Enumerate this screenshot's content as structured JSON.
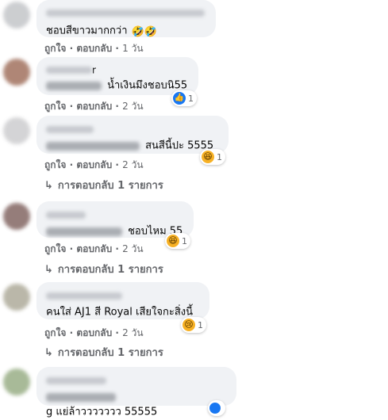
{
  "comments": [
    {
      "text": "ชอบสีขาวมากกว่า",
      "emoji": "🤣🤣",
      "actions": {
        "like": "ถูกใจ",
        "reply": "ตอบกลับ",
        "time": "1 วัน",
        "sep": "·"
      },
      "avatar_color": "#c7c9cc"
    },
    {
      "name_fragment": "r",
      "text": "น้ำเงินมึงชอบนิ55",
      "actions": {
        "like": "ถูกใจ",
        "reply": "ตอบกลับ",
        "time": "2 วัน",
        "sep": "·"
      },
      "reaction": {
        "icon": "like-icon",
        "glyph": "👍",
        "count": "1"
      },
      "avatar_color": "#a77a68"
    },
    {
      "text": "สนสีนี้ปะ 5555",
      "actions": {
        "like": "ถูกใจ",
        "reply": "ตอบกลับ",
        "time": "2 วัน",
        "sep": "·"
      },
      "reaction": {
        "icon": "haha-icon",
        "glyph": "😆",
        "count": "1"
      },
      "replies": {
        "arrow": "↳",
        "label": "การตอบกลับ 1 รายการ"
      },
      "avatar_color": "#d0d0d2"
    },
    {
      "text": "ชอบไหม 55",
      "actions": {
        "like": "ถูกใจ",
        "reply": "ตอบกลับ",
        "time": "2 วัน",
        "sep": "·"
      },
      "reaction": {
        "icon": "haha-icon",
        "glyph": "😆",
        "count": "1"
      },
      "replies": {
        "arrow": "↳",
        "label": "การตอบกลับ 1 รายการ"
      },
      "avatar_color": "#8a6f6c"
    },
    {
      "text": "คนใส่ AJ1 สี Royal เสียใจกะสิ่งนี้",
      "actions": {
        "like": "ถูกใจ",
        "reply": "ตอบกลับ",
        "time": "2 วัน",
        "sep": "·"
      },
      "reaction": {
        "icon": "sad-icon",
        "glyph": "😢",
        "count": "1"
      },
      "replies": {
        "arrow": "↳",
        "label": "การตอบกลับ 1 รายการ"
      },
      "avatar_color": "#b3b0a0"
    },
    {
      "text": "g แย่ล้าววววววว 55555",
      "avatar_color": "#9fb38d"
    }
  ]
}
